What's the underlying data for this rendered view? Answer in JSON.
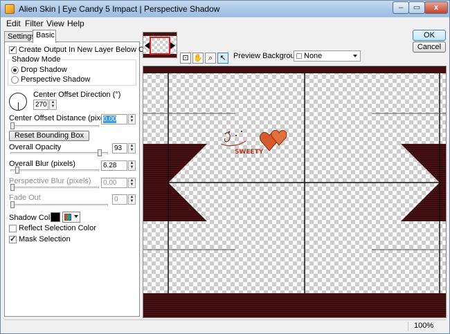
{
  "window": {
    "title": "Alien Skin | Eye Candy 5 Impact | Perspective Shadow",
    "icon": "alien-skin-app-icon",
    "controls": {
      "minimize": "–",
      "maximize": "▭",
      "close": "x"
    }
  },
  "menu": [
    "Edit",
    "Filter",
    "View",
    "Help"
  ],
  "tabs": {
    "settings": "Settings",
    "basic": "Basic"
  },
  "basic": {
    "create_output_label": "Create Output In New Layer Below Current",
    "create_output_checked": true,
    "shadow_mode": {
      "title": "Shadow Mode",
      "options": [
        "Drop Shadow",
        "Perspective Shadow"
      ],
      "selected": "Drop Shadow"
    },
    "center_offset_direction": {
      "label": "Center Offset Direction (°)",
      "value": "270"
    },
    "center_offset_distance": {
      "label": "Center Offset Distance (pixels)",
      "value": "0.00",
      "slider_fraction": 0.0
    },
    "reset_bounding_box": "Reset Bounding Box",
    "overall_opacity": {
      "label": "Overall Opacity",
      "value": "93",
      "slider_fraction": 0.93
    },
    "overall_blur": {
      "label": "Overall Blur (pixels)",
      "value": "6.28",
      "slider_fraction": 0.06
    },
    "perspective_blur": {
      "label": "Perspective Blur (pixels)",
      "value": "0.00",
      "slider_fraction": 0.0,
      "enabled": false
    },
    "fade_out": {
      "label": "Fade Out",
      "value": "0",
      "slider_fraction": 0.0,
      "enabled": false
    },
    "shadow_color": {
      "label": "Shadow Color",
      "swatch": "#000000"
    },
    "reflect_selection_color": {
      "label": "Reflect Selection Color",
      "checked": false
    },
    "mask_selection": {
      "label": "Mask Selection",
      "checked": true
    }
  },
  "buttons": {
    "ok": "OK",
    "cancel": "Cancel"
  },
  "toolbar": {
    "tools": [
      "zoom-to-fit-icon",
      "hand-pan-icon",
      "magnifier-icon",
      "pointer-arrow-icon"
    ],
    "preview_background_label": "Preview Background:",
    "preview_background_value": "None"
  },
  "preview": {
    "band_color": "#4a1115",
    "wordart_text": "SWEETY"
  },
  "status": {
    "zoom": "100%"
  }
}
